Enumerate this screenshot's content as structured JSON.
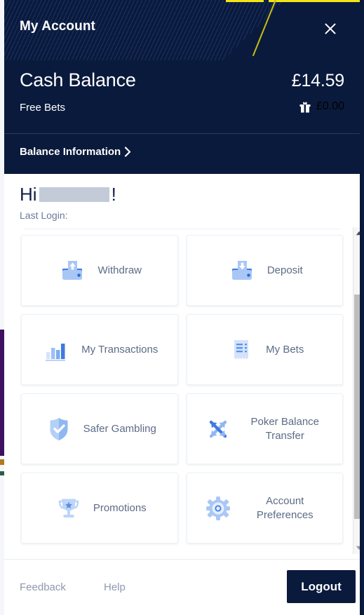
{
  "window": {
    "title": "My Account",
    "close_icon": "close-icon"
  },
  "theme": {
    "header_bg": "#0a1a3c",
    "accent_yellow": "#f2e416",
    "panel_bg": "#ffffff",
    "icon_blue": "#4a86e8",
    "icon_blue_light": "#a9c7f5",
    "label_color": "#5d6b86",
    "logout_bg": "#0a1a3c"
  },
  "balance": {
    "cash_label": "Cash Balance",
    "cash_value": "£14.59",
    "free_bets_label": "Free Bets",
    "free_bets_icon": "gift-icon",
    "free_bets_value": "£0.00",
    "balance_information_label": "Balance Information",
    "balance_information_chevron": "chevron-right-icon"
  },
  "greeting": {
    "hi": "Hi",
    "username_redacted": "",
    "exclamation": "!",
    "last_login": "Last Login:"
  },
  "tiles": [
    {
      "label": "Withdraw",
      "icon": "wallet-up-arrow-icon"
    },
    {
      "label": "Deposit",
      "icon": "wallet-down-arrow-icon"
    },
    {
      "label": "My\nTransactions",
      "label_line1": "My",
      "label_line2": "Transactions",
      "icon": "bar-chart-icon"
    },
    {
      "label": "My Bets",
      "icon": "receipt-icon"
    },
    {
      "label": "Safer\nGambling",
      "label_line1": "Safer",
      "label_line2": "Gambling",
      "icon": "shield-check-icon"
    },
    {
      "label": "Poker\nBalance\nTransfer",
      "label_line1": "Poker",
      "label_line2": "Balance",
      "label_line3": "Transfer",
      "icon": "transfer-arrows-icon"
    },
    {
      "label": "Promotions",
      "icon": "trophy-star-icon"
    },
    {
      "label": "Account\nPreferences",
      "label_line1": "Account",
      "label_line2": "Preferences",
      "icon": "gear-icon"
    }
  ],
  "scrollbar": {
    "up_icon": "scroll-up-arrow-icon",
    "down_icon": "scroll-down-arrow-icon",
    "thumb": "scrollbar-thumb"
  },
  "footer": {
    "feedback_label": "Feedback",
    "help_label": "Help",
    "logout_label": "Logout"
  }
}
